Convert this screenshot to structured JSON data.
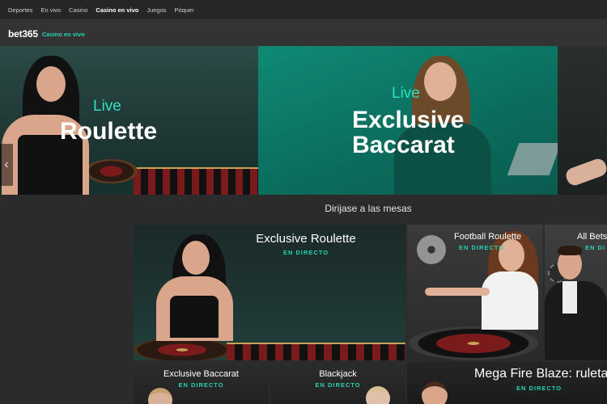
{
  "topnav": {
    "items": [
      {
        "label": "Deportes"
      },
      {
        "label": "En vivo"
      },
      {
        "label": "Casino"
      },
      {
        "label": "Casino en vivo",
        "active": true
      },
      {
        "label": "Juegos"
      },
      {
        "label": "Póquer"
      }
    ]
  },
  "brand": {
    "logo": "bet365",
    "subtitle": "Casino en vivo"
  },
  "hero": {
    "slides": [
      {
        "live": "Live",
        "title": "Roulette"
      },
      {
        "live": "Live",
        "title_line1": "Exclusive",
        "title_line2": "Baccarat"
      }
    ],
    "prev_arrow": "‹"
  },
  "section_title": "Dirĳase a las mesas",
  "tiles": {
    "exclusive_roulette": {
      "name": "Exclusive Roulette",
      "status": "EN DIRECTO"
    },
    "football_roulette": {
      "name": "Football Roulette",
      "status": "EN DIRECTO"
    },
    "all_bets": {
      "name": "All Bets",
      "status": "EN DI"
    },
    "exclusive_baccarat": {
      "name": "Exclusive Baccarat",
      "status": "EN DIRECTO"
    },
    "blackjack": {
      "name": "Blackjack",
      "status": "EN DIRECTO"
    },
    "mega_fire_blaze": {
      "name": "Mega Fire Blaze: ruleta",
      "status": "EN DIRECTO"
    }
  },
  "colors": {
    "accent": "#26d4b4",
    "background": "#2b2b2b",
    "hero_teal": "#0b6e5e"
  }
}
